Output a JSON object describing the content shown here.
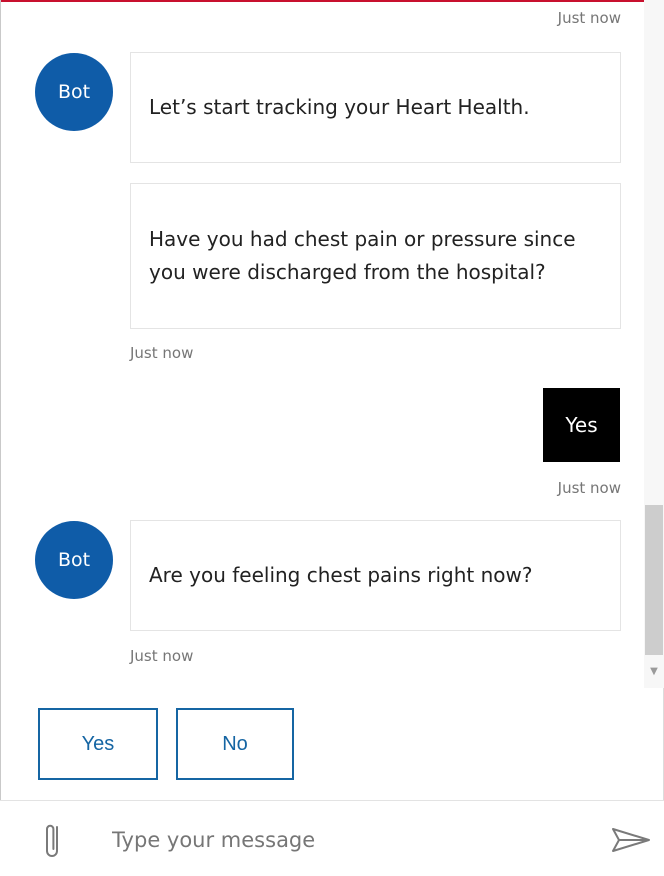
{
  "transcript": {
    "top_timestamp": "Just now",
    "messages": [
      {
        "avatar_label": "Bot",
        "bubbles": [
          "Let’s start tracking your Heart Health.",
          "Have you had chest pain or pressure since you were discharged from the hospital?"
        ],
        "timestamp": "Just now"
      },
      {
        "user_text": "Yes",
        "timestamp": "Just now"
      },
      {
        "avatar_label": "Bot",
        "bubbles": [
          "Are you feeling chest pains right now?"
        ],
        "timestamp": "Just now"
      }
    ]
  },
  "suggested_actions": [
    "Yes",
    "No"
  ],
  "composer": {
    "placeholder": "Type your message"
  },
  "icons": {
    "attach": "paperclip-icon",
    "send": "send-icon"
  },
  "colors": {
    "accent": "#c8102e",
    "bot_avatar": "#0f5ca8",
    "action_border": "#1565a3",
    "user_bubble": "#000000"
  }
}
